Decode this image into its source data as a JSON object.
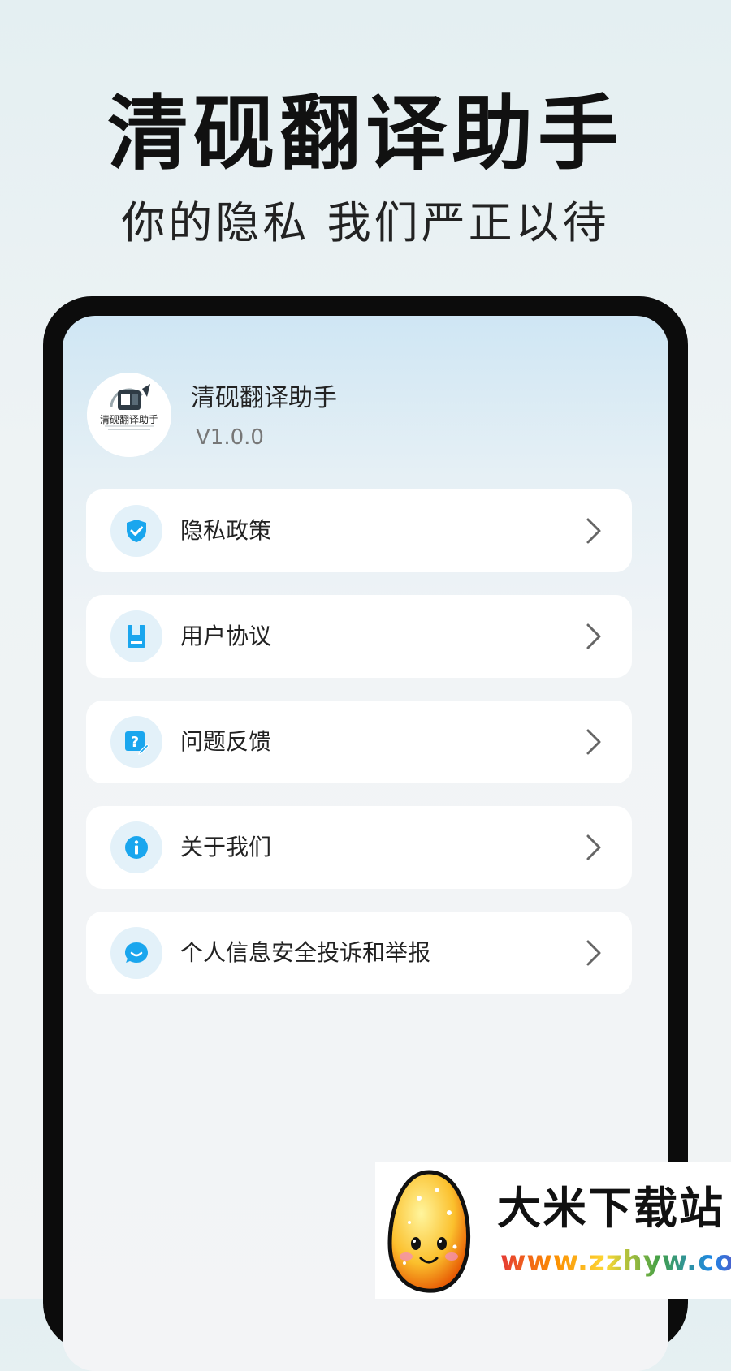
{
  "hero": {
    "title": "清砚翻译助手",
    "subtitle": "你的隐私 我们严正以待"
  },
  "app": {
    "name": "清砚翻译助手",
    "version": "V1.0.0",
    "logo_text": "清砚翻译助手",
    "logo_icon": "translate-icon"
  },
  "menu": {
    "items": [
      {
        "label": "隐私政策",
        "icon": "shield-check-icon"
      },
      {
        "label": "用户协议",
        "icon": "document-icon"
      },
      {
        "label": "问题反馈",
        "icon": "feedback-question-icon"
      },
      {
        "label": "关于我们",
        "icon": "info-icon"
      },
      {
        "label": "个人信息安全投诉和举报",
        "icon": "chat-smile-icon"
      }
    ],
    "chevron_icon": "chevron-right-icon"
  },
  "watermark": {
    "name": "大米下载站",
    "url": "www.zzhyw.com"
  },
  "colors": {
    "accent": "#1aa6ee",
    "icon_bg": "#e3f1f9",
    "frame": "#0c0c0c"
  }
}
